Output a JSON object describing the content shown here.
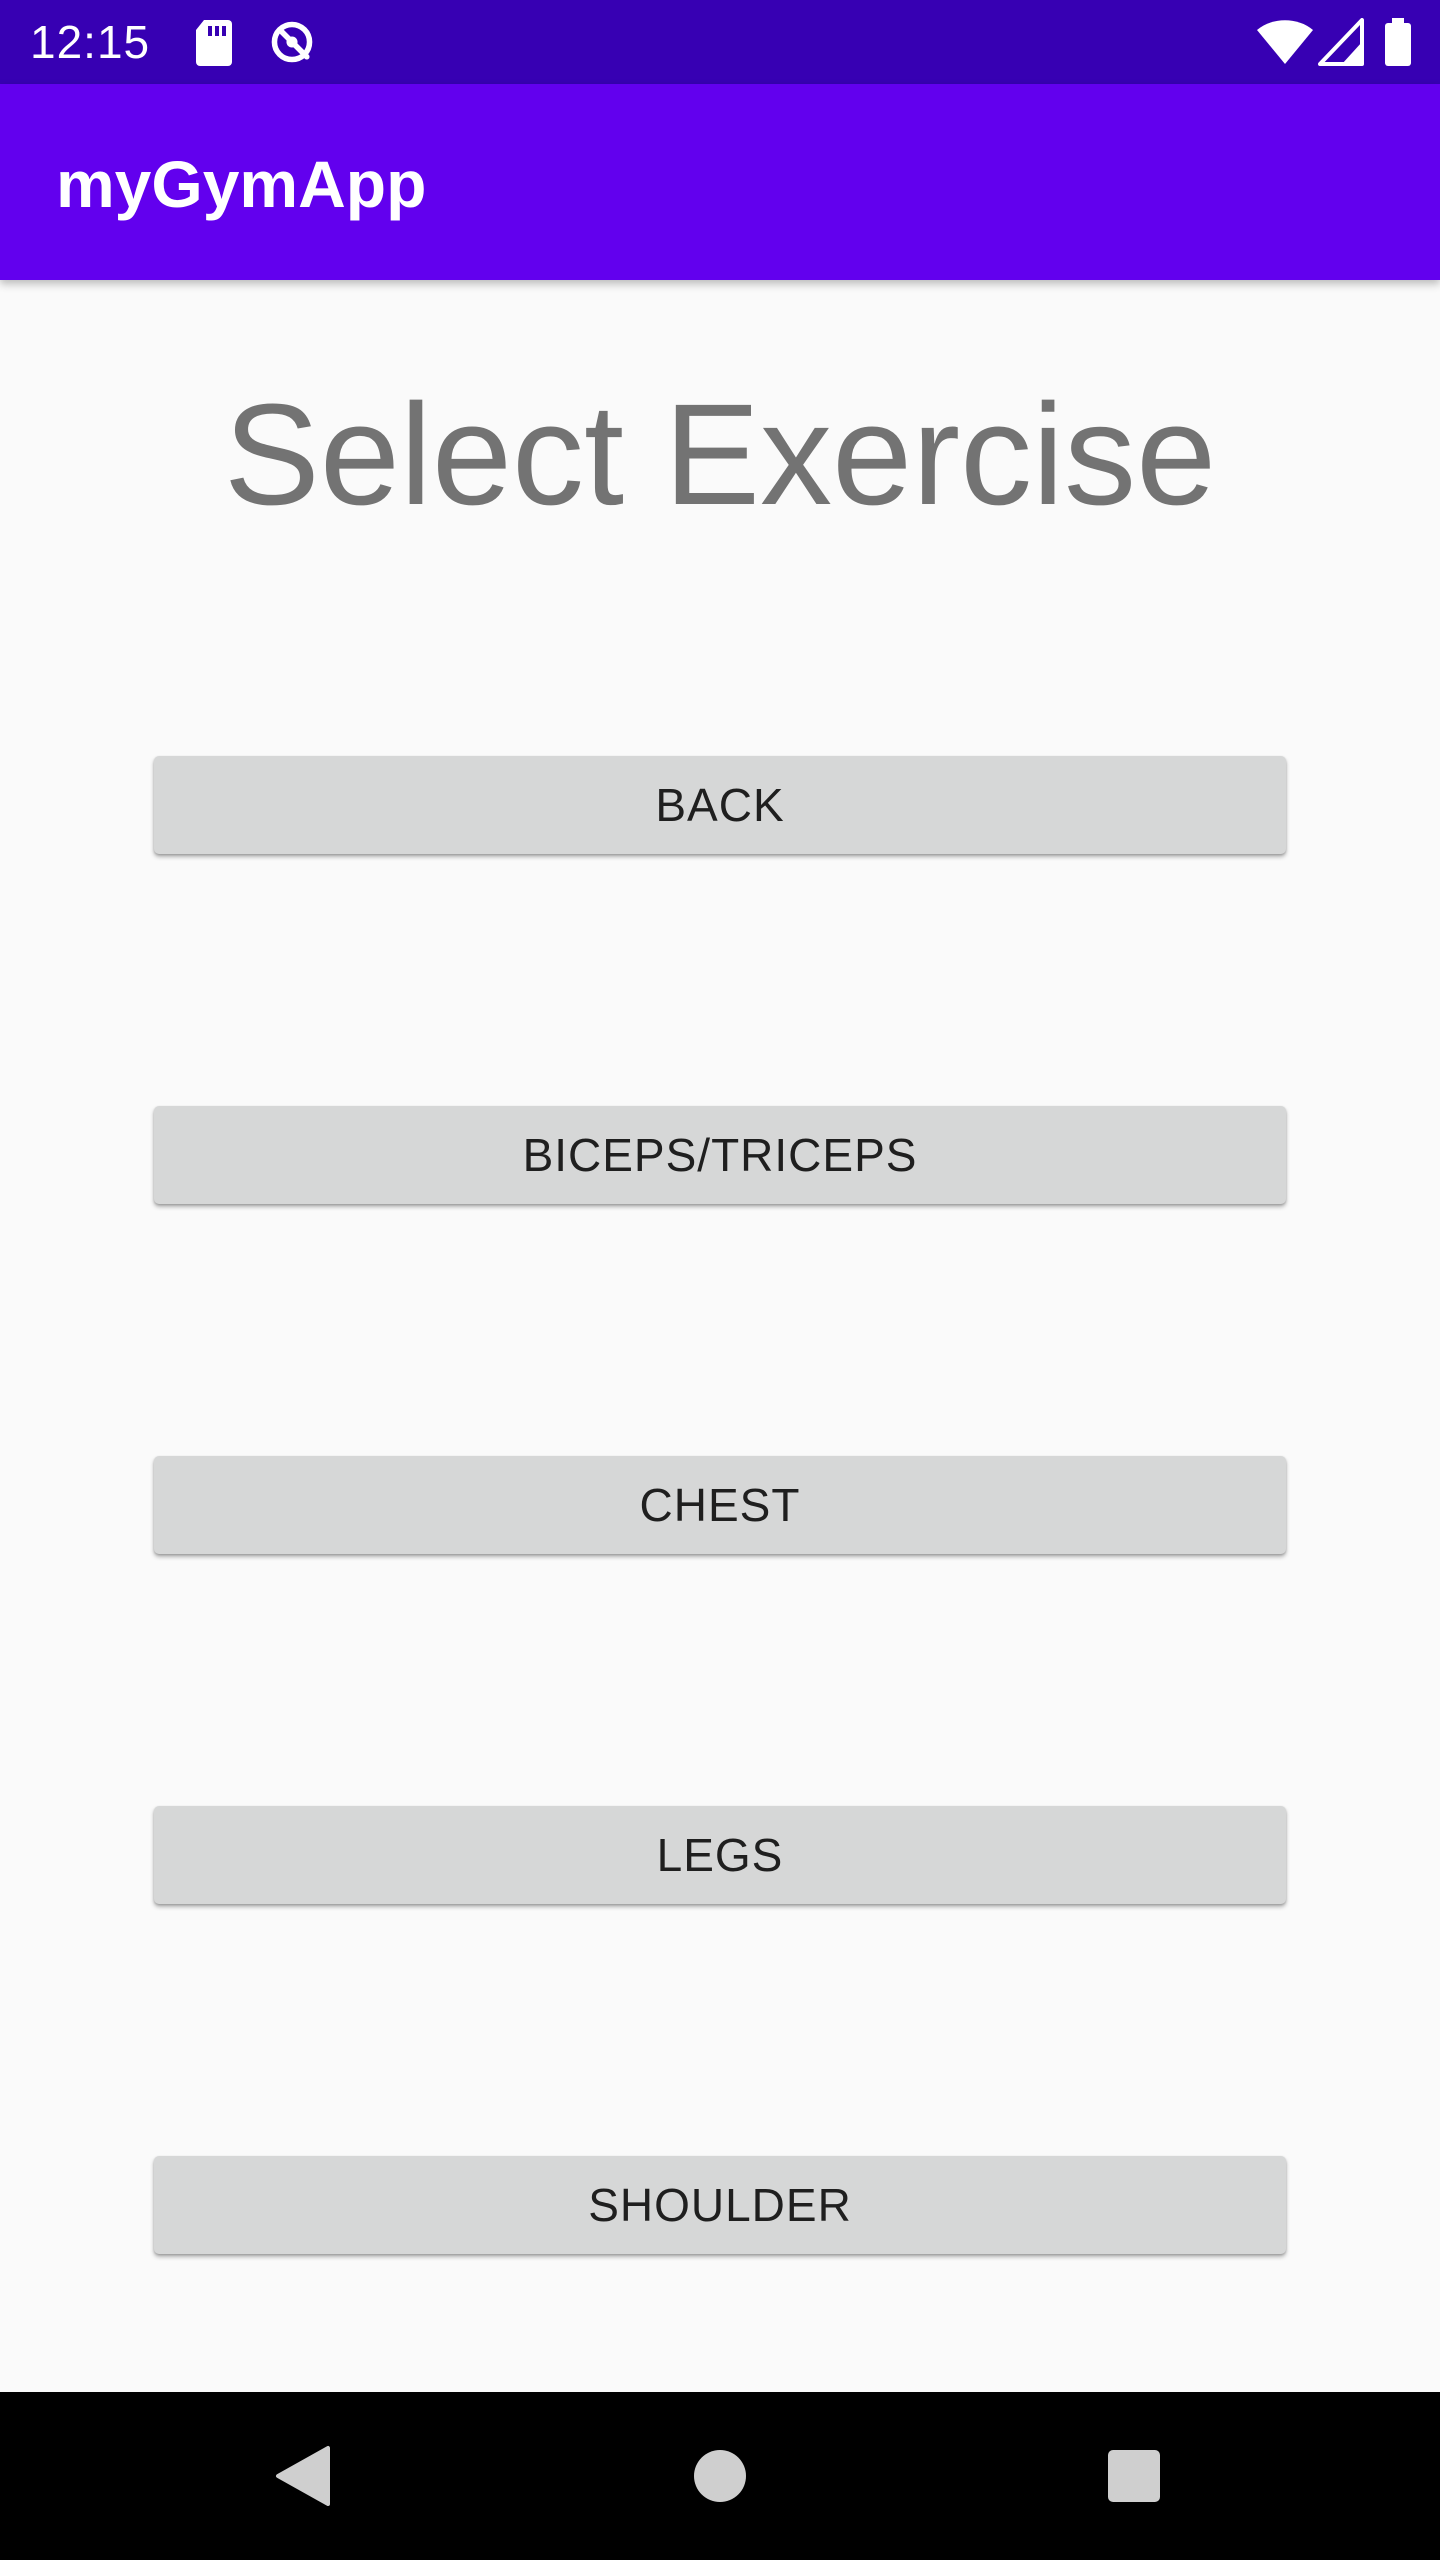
{
  "status_bar": {
    "time": "12:15",
    "left_icons": [
      "sd-card-icon",
      "sync-disabled-icon"
    ],
    "right_icons": [
      "wifi-icon",
      "cell-signal-icon",
      "battery-icon"
    ]
  },
  "app_bar": {
    "title": "myGymApp",
    "color": "#6200EE"
  },
  "main": {
    "heading": "Select Exercise",
    "buttons": [
      {
        "label": "BACK"
      },
      {
        "label": "BICEPS/TRICEPS"
      },
      {
        "label": "CHEST"
      },
      {
        "label": "LEGS"
      },
      {
        "label": "SHOULDER"
      }
    ]
  },
  "nav_bar": {
    "icons": [
      "back-nav-icon",
      "home-nav-icon",
      "recents-nav-icon"
    ]
  },
  "colors": {
    "status_bar": "#3700B3",
    "app_bar": "#6200EE",
    "background": "#FAFAFA",
    "button": "#D6D7D7",
    "heading_text": "#737373"
  }
}
